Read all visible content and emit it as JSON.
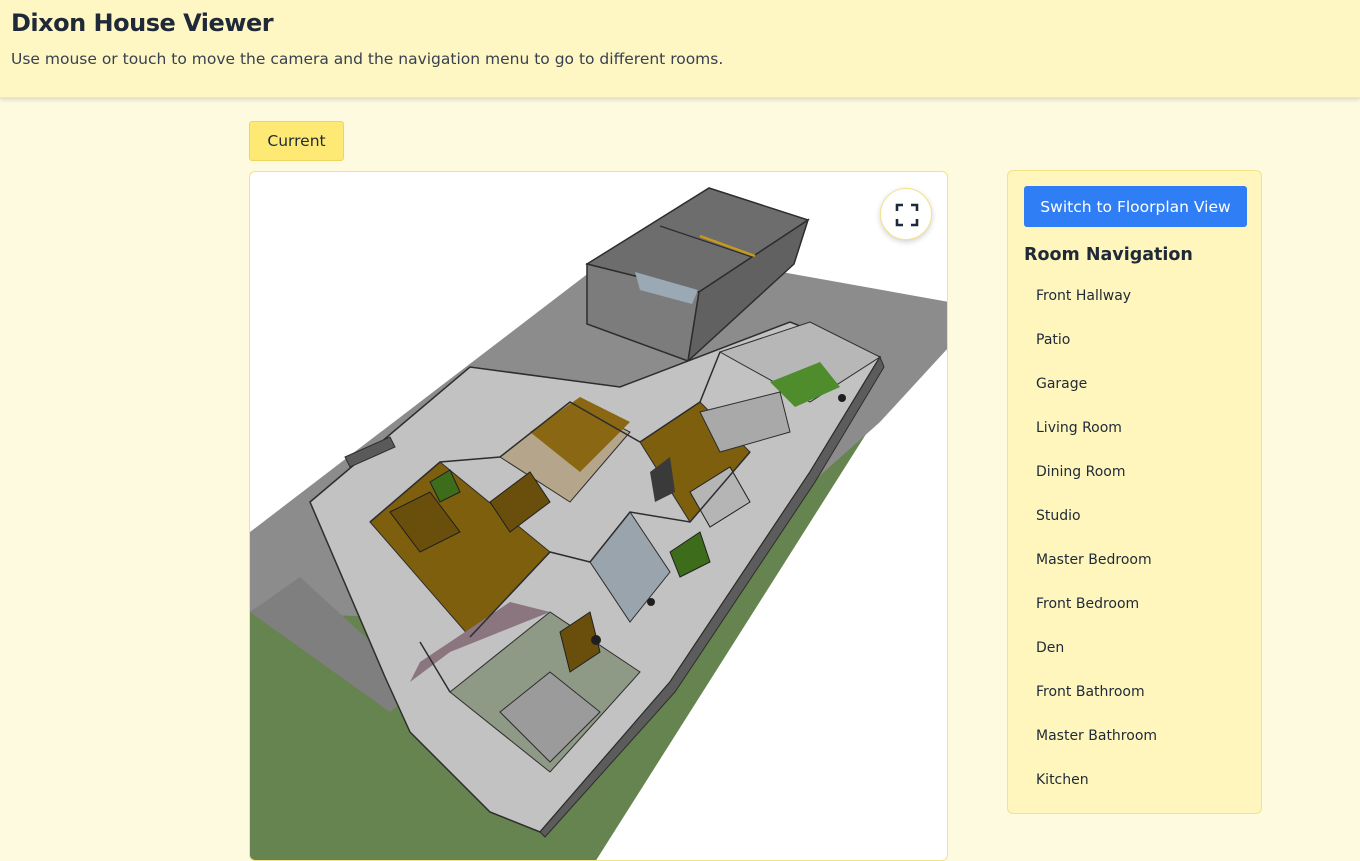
{
  "header": {
    "title": "Dixon House Viewer",
    "subtitle": "Use mouse or touch to move the camera and the navigation menu to go to different rooms."
  },
  "toolbar": {
    "current_label": "Current"
  },
  "viewer": {
    "fullscreen_icon": "fullscreen-icon",
    "colors": {
      "lawn": "#66844f",
      "concrete": "#8c8c8c",
      "wall": "#c9c9c9",
      "wood_floor": "#7d5f0d",
      "carpet": "#8f9a86"
    }
  },
  "panel": {
    "switch_label": "Switch to Floorplan View",
    "nav_title": "Room Navigation",
    "rooms": [
      "Front Hallway",
      "Patio",
      "Garage",
      "Living Room",
      "Dining Room",
      "Studio",
      "Master Bedroom",
      "Front Bedroom",
      "Den",
      "Front Bathroom",
      "Master Bathroom",
      "Kitchen"
    ],
    "accent": "#2f7ef5"
  }
}
